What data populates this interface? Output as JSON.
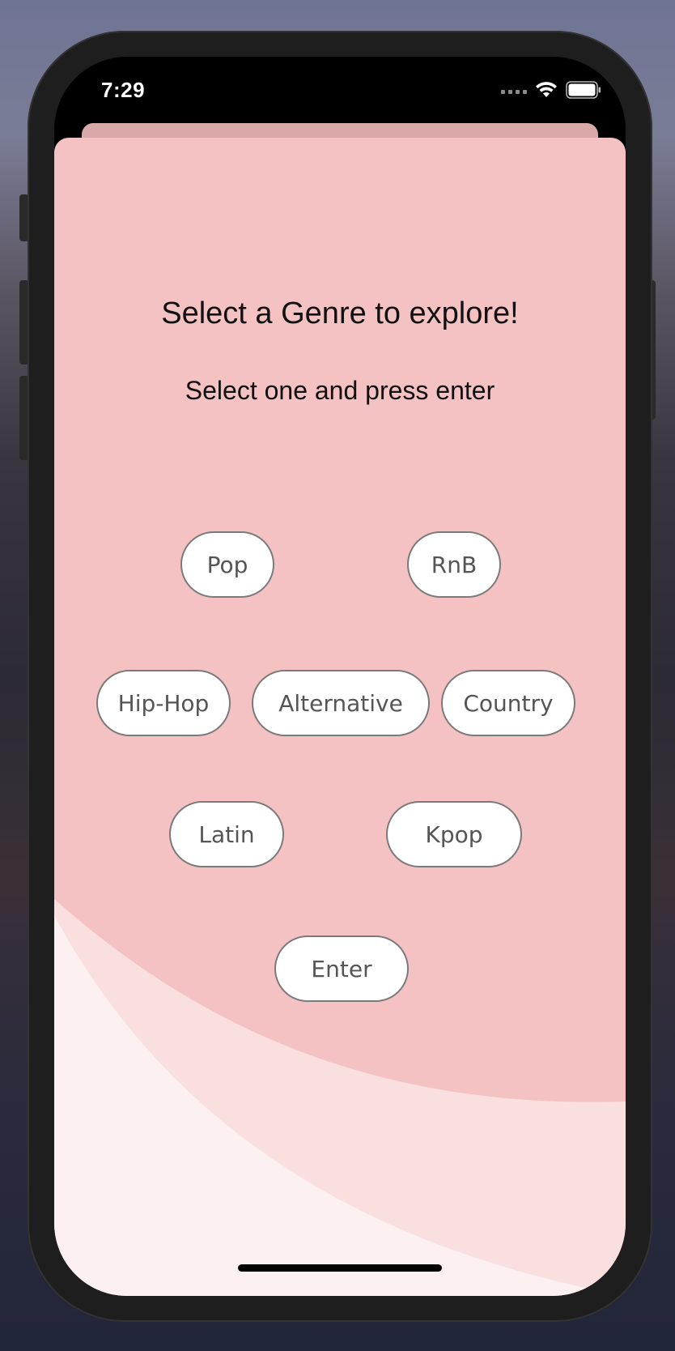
{
  "status_bar": {
    "time": "7:29"
  },
  "screen": {
    "title": "Select a Genre to explore!",
    "subtitle": "Select one and press enter"
  },
  "genres": {
    "pop": "Pop",
    "rnb": "RnB",
    "hiphop": "Hip-Hop",
    "alternative": "Alternative",
    "country": "Country",
    "latin": "Latin",
    "kpop": "Kpop"
  },
  "actions": {
    "enter": "Enter"
  },
  "colors": {
    "background": "#f4c2c2",
    "wave_mid": "#fadfdf",
    "wave_light": "#fdf0f0",
    "button_bg": "#ffffff",
    "button_border": "#7a7a7a"
  }
}
